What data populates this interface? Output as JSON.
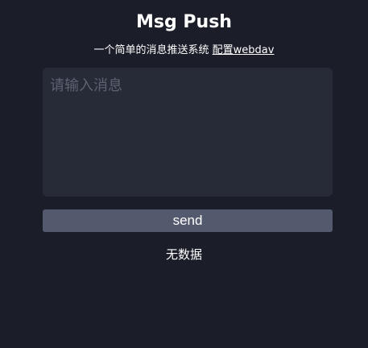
{
  "header": {
    "title": "Msg Push",
    "subtitle_text": "一个简单的消息推送系统",
    "config_link": "配置webdav"
  },
  "composer": {
    "message_value": "",
    "message_placeholder": "请输入消息",
    "send_label": "send"
  },
  "messages": {
    "empty_text": "无数据",
    "items": []
  },
  "colors": {
    "background": "#1b1d29",
    "input_background": "#272a37",
    "button_background": "#545a6d",
    "text": "#ffffff",
    "placeholder": "#5e6270"
  }
}
